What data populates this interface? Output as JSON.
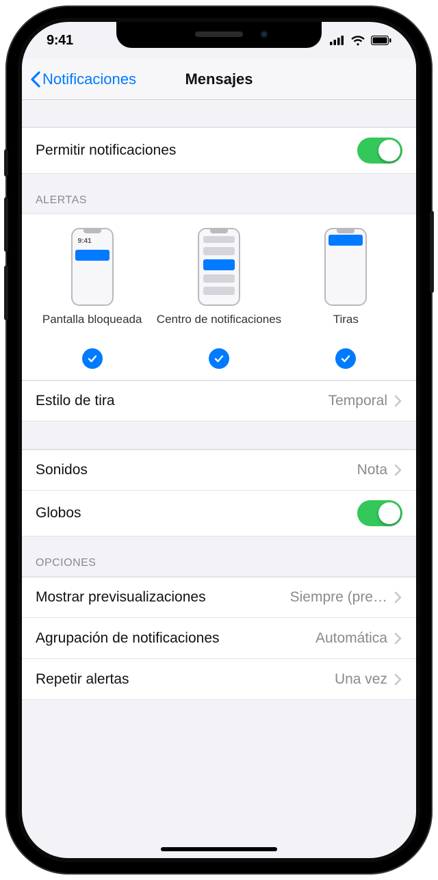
{
  "status": {
    "time": "9:41"
  },
  "nav": {
    "back": "Notificaciones",
    "title": "Mensajes"
  },
  "allow": {
    "label": "Permitir notificaciones",
    "on": true
  },
  "alerts": {
    "header": "ALERTAS",
    "options": [
      {
        "label": "Pantalla bloqueada",
        "checked": true
      },
      {
        "label": "Centro de notificaciones",
        "checked": true
      },
      {
        "label": "Tiras",
        "checked": true
      }
    ],
    "mini_time": "9:41",
    "banner_style": {
      "label": "Estilo de tira",
      "value": "Temporal"
    }
  },
  "sounds": {
    "label": "Sonidos",
    "value": "Nota"
  },
  "badges": {
    "label": "Globos",
    "on": true
  },
  "options": {
    "header": "OPCIONES",
    "show_previews": {
      "label": "Mostrar previsualizaciones",
      "value": "Siempre (pre…"
    },
    "grouping": {
      "label": "Agrupación de notificaciones",
      "value": "Automática"
    },
    "repeat": {
      "label": "Repetir alertas",
      "value": "Una vez"
    }
  }
}
